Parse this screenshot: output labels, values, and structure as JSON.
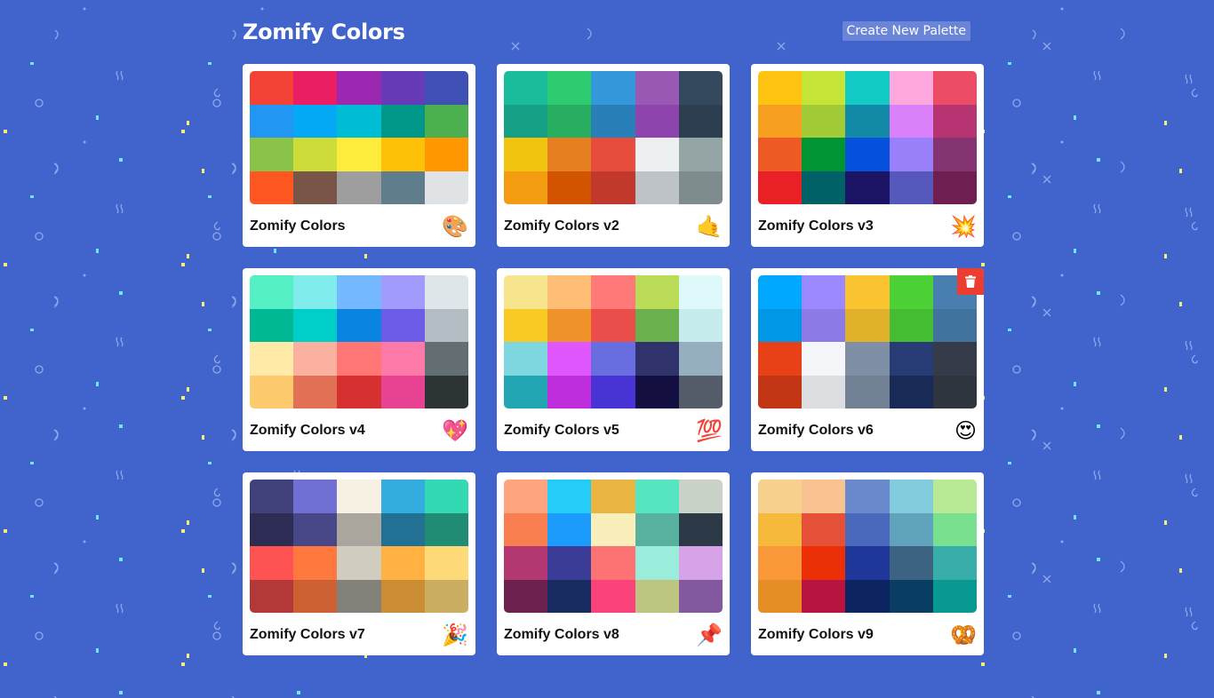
{
  "header": {
    "title": "Zomify Colors",
    "create_button_label": "Create New Palette"
  },
  "colors": {
    "background": "#4163cc",
    "card": "#ffffff",
    "delete": "#eb3d30"
  },
  "palettes": [
    {
      "name": "Zomify Colors",
      "emoji": "🎨",
      "colors": [
        "#f44336",
        "#e91e63",
        "#9c27b0",
        "#673ab7",
        "#3f51b5",
        "#2196f3",
        "#03a9f4",
        "#00bcd4",
        "#009688",
        "#4caf50",
        "#8bc34a",
        "#cddc39",
        "#ffeb3b",
        "#ffc107",
        "#ff9800",
        "#ff5722",
        "#795548",
        "#9e9e9e",
        "#607d8b",
        "#dfe3e6"
      ]
    },
    {
      "name": "Zomify Colors v2",
      "emoji": "🤙",
      "colors": [
        "#1abc9c",
        "#2ecc71",
        "#3498db",
        "#9b59b6",
        "#34495e",
        "#16a085",
        "#27ae60",
        "#2980b9",
        "#8e44ad",
        "#2c3e50",
        "#f1c40f",
        "#e67e22",
        "#e74c3c",
        "#ecf0f1",
        "#95a5a6",
        "#f39c12",
        "#d35400",
        "#c0392b",
        "#bdc3c7",
        "#7f8c8d"
      ]
    },
    {
      "name": "Zomify Colors v3",
      "emoji": "💥",
      "colors": [
        "#ffc312",
        "#c4e538",
        "#12cbc4",
        "#fda7df",
        "#ed4c67",
        "#f79f1f",
        "#a3cb38",
        "#1289a7",
        "#d980fa",
        "#b53471",
        "#ee5a24",
        "#009432",
        "#0652dd",
        "#9980fa",
        "#833471",
        "#ea2027",
        "#006266",
        "#1b1464",
        "#5758bb",
        "#6f1e51"
      ]
    },
    {
      "name": "Zomify Colors v4",
      "emoji": "💖",
      "colors": [
        "#55efc4",
        "#81ecec",
        "#74b9ff",
        "#a29bfe",
        "#dfe6e9",
        "#00b894",
        "#00cec9",
        "#0984e3",
        "#6c5ce7",
        "#b2bec3",
        "#ffeaa7",
        "#fab1a0",
        "#ff7675",
        "#fd79a8",
        "#636e72",
        "#fdcb6e",
        "#e17055",
        "#d63031",
        "#e84393",
        "#2d3436"
      ]
    },
    {
      "name": "Zomify Colors v5",
      "emoji": "💯",
      "colors": [
        "#f6e58d",
        "#ffbe76",
        "#ff7979",
        "#badc58",
        "#dff9fb",
        "#f9ca24",
        "#f0932b",
        "#eb4d4b",
        "#6ab04c",
        "#c7ecee",
        "#7ed6df",
        "#e056fd",
        "#686de0",
        "#30336b",
        "#95afc0",
        "#22a6b3",
        "#be2edd",
        "#4834d4",
        "#130f40",
        "#535c68"
      ]
    },
    {
      "name": "Zomify Colors v6",
      "emoji": "😍",
      "colors": [
        "#00a8ff",
        "#9c88ff",
        "#fbc531",
        "#4cd137",
        "#487eb0",
        "#0097e6",
        "#8c7ae6",
        "#e1b12c",
        "#44bd32",
        "#40739e",
        "#e84118",
        "#f5f6fa",
        "#7f8fa6",
        "#273c75",
        "#353b48",
        "#c23616",
        "#dcdde1",
        "#718093",
        "#192a56",
        "#2f3640"
      ]
    },
    {
      "name": "Zomify Colors v7",
      "emoji": "🎉",
      "colors": [
        "#40407a",
        "#706fd3",
        "#f7f1e3",
        "#34ace0",
        "#33d9b2",
        "#2c2c54",
        "#474787",
        "#aaa69d",
        "#227093",
        "#218c74",
        "#ff5252",
        "#ff793f",
        "#d1ccc0",
        "#ffb142",
        "#ffda79",
        "#b33939",
        "#cd6133",
        "#84817a",
        "#cc8e35",
        "#ccae62"
      ]
    },
    {
      "name": "Zomify Colors v8",
      "emoji": "📌",
      "colors": [
        "#fea47f",
        "#25ccf7",
        "#eab543",
        "#55e6c1",
        "#cad3c8",
        "#f97f51",
        "#1b9cfc",
        "#f8efba",
        "#58b19f",
        "#2c3a47",
        "#b33771",
        "#3b3b98",
        "#fd7272",
        "#9aecdb",
        "#d6a2e8",
        "#6d214f",
        "#182c61",
        "#fc427b",
        "#bdc581",
        "#82589f"
      ]
    },
    {
      "name": "Zomify Colors v9",
      "emoji": "🥨",
      "colors": [
        "#f8d08d",
        "#f8c291",
        "#6a89cc",
        "#82ccdd",
        "#b8e994",
        "#f6b93b",
        "#e55039",
        "#4a69bd",
        "#60a3bc",
        "#78e08f",
        "#fa983a",
        "#eb2f06",
        "#1e3799",
        "#3c6382",
        "#38ada9",
        "#e58e26",
        "#b71540",
        "#0c2461",
        "#0a3d62",
        "#079992"
      ]
    }
  ],
  "delete_button_on_index": 5
}
